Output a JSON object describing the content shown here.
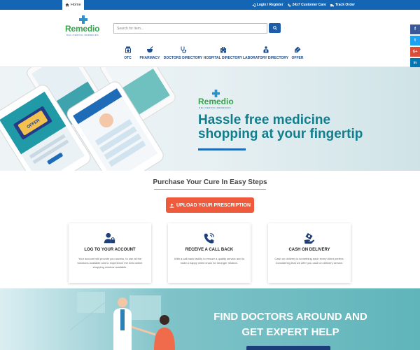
{
  "topbar": {
    "home_label": "Home",
    "links": [
      "Login / Register",
      "24x7 Customer Care",
      "Track Order"
    ]
  },
  "brand": {
    "name": "Remedio",
    "tagline": "DELIVERING REMEDIES"
  },
  "search": {
    "placeholder": "Search for item..."
  },
  "nav": {
    "items": [
      "OTC",
      "PHARMACY",
      "DOCTORS DIRECTORY",
      "HOSPITAL DIRECTORY",
      "LABORATORY DIRECTORY",
      "OFFER"
    ]
  },
  "social": {
    "items": [
      "f",
      "t",
      "G+",
      "in",
      "P"
    ]
  },
  "hero": {
    "title": "Hassle free medicine shopping at your fingertip",
    "coupon_text": "OFFER"
  },
  "steps": {
    "title": "Purchase Your Cure In Easy Steps",
    "upload_label": "UPLOAD YOUR PRESCRIPTION",
    "cards": [
      {
        "title": "LOG TO YOUR ACCOUNT",
        "text": "Your account will provide you access, to use all the functions available and to experience the best online shopping window available."
      },
      {
        "title": "RECEIVE A CALL BACK",
        "text": "With a call back facility to ensure a quality service and to build a happy client chain for stronger relation."
      },
      {
        "title": "CASH ON DELIVERY",
        "text": "Cash on delivery is something each every client prefers. Considering that we offer you cash on delivery service."
      }
    ]
  },
  "banner": {
    "title": "FIND DOCTORS AROUND AND GET EXPERT HELP"
  },
  "colors": {
    "primary": "#1565b5",
    "brand_green": "#33a64a",
    "accent": "#f05a3c",
    "teal": "#0f7e8d"
  }
}
